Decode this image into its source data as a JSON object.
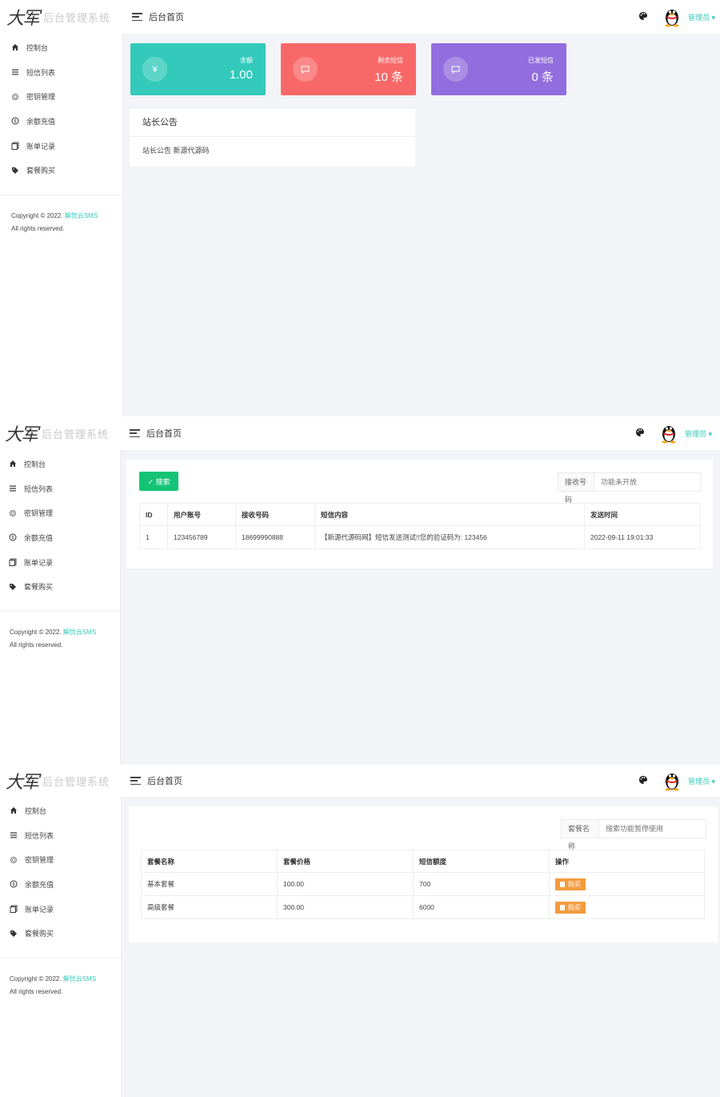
{
  "app": {
    "logo_mark": "大军",
    "logo_text": "后台管理系统"
  },
  "sidebar": {
    "items": [
      {
        "label": "控制台",
        "icon": "home-icon"
      },
      {
        "label": "短信列表",
        "icon": "list-icon"
      },
      {
        "label": "密钥管理",
        "icon": "key-icon"
      },
      {
        "label": "余额充值",
        "icon": "coin-icon"
      },
      {
        "label": "账单记录",
        "icon": "bill-icon"
      },
      {
        "label": "套餐购买",
        "icon": "tag-icon"
      }
    ],
    "copyright_prefix": "Copyright © 2022. ",
    "copyright_brand": "解忧云SMS",
    "rights": "All rights reserved."
  },
  "topbar": {
    "breadcrumb": "后台首页",
    "user": "管理员 ▾"
  },
  "dashboard": {
    "stats": [
      {
        "label": "余额",
        "value": "1.00",
        "icon": "yen",
        "color": "#33cabb"
      },
      {
        "label": "剩余短信",
        "value": "10 条",
        "icon": "msg",
        "color": "#f96868"
      },
      {
        "label": "已发短信",
        "value": "0 条",
        "icon": "msg",
        "color": "#926dde"
      }
    ],
    "notice_title": "站长公告",
    "notice_body": "站长公告 新源代源码"
  },
  "sms_list": {
    "search_button": "✓ 搜索",
    "filter_key": "接收号码",
    "filter_placeholder": "功能未开放",
    "columns": [
      "ID",
      "用户账号",
      "接收号码",
      "短信内容",
      "发送时间"
    ],
    "rows": [
      [
        "1",
        "123456789",
        "18699990888",
        "【新源代源码网】短信发送测试!!您的验证码为: 123456",
        "2022-09-11 19:01:33"
      ]
    ]
  },
  "packages": {
    "filter_key": "套餐名称",
    "filter_placeholder": "搜索功能暂停使用",
    "columns": [
      "套餐名称",
      "套餐价格",
      "短信额度",
      "操作"
    ],
    "rows": [
      {
        "name": "基本套餐",
        "price": "100.00",
        "quota": "700",
        "action": "购买"
      },
      {
        "name": "高级套餐",
        "price": "300.00",
        "quota": "6000",
        "action": "购买"
      }
    ]
  },
  "colors": {
    "accent": "#33cabb",
    "success": "#15c377",
    "warning": "#f39c40"
  }
}
